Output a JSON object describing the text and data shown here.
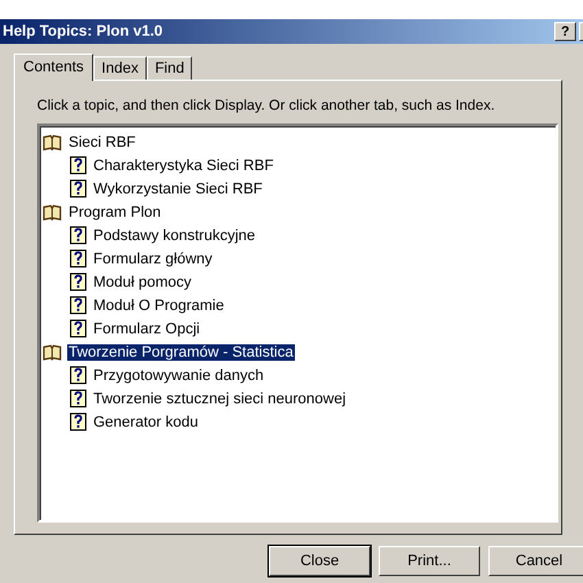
{
  "window": {
    "title": "Help Topics: Plon v1.0",
    "help_button": "?"
  },
  "tabs": [
    {
      "label": "Contents",
      "selected": true
    },
    {
      "label": "Index",
      "selected": false
    },
    {
      "label": "Find",
      "selected": false
    }
  ],
  "instruction": "Click a topic, and then click Display. Or click another tab, such as Index.",
  "tree": [
    {
      "kind": "book",
      "label": "Sieci RBF",
      "selected": false,
      "children": [
        {
          "kind": "topic",
          "label": "Charakterystyka Sieci RBF",
          "selected": false
        },
        {
          "kind": "topic",
          "label": "Wykorzystanie Sieci RBF",
          "selected": false
        }
      ]
    },
    {
      "kind": "book",
      "label": "Program Plon",
      "selected": false,
      "children": [
        {
          "kind": "topic",
          "label": "Podstawy konstrukcyjne",
          "selected": false
        },
        {
          "kind": "topic",
          "label": "Formularz główny",
          "selected": false
        },
        {
          "kind": "topic",
          "label": "Moduł pomocy",
          "selected": false
        },
        {
          "kind": "topic",
          "label": "Moduł O Programie",
          "selected": false
        },
        {
          "kind": "topic",
          "label": "Formularz Opcji",
          "selected": false
        }
      ]
    },
    {
      "kind": "book",
      "label": "Tworzenie Porgramów - Statistica",
      "selected": true,
      "children": [
        {
          "kind": "topic",
          "label": "Przygotowywanie danych",
          "selected": false
        },
        {
          "kind": "topic",
          "label": "Tworzenie sztucznej sieci neuronowej",
          "selected": false
        },
        {
          "kind": "topic",
          "label": "Generator kodu",
          "selected": false
        }
      ]
    }
  ],
  "buttons": [
    {
      "label": "Close",
      "default": true
    },
    {
      "label": "Print...",
      "default": false
    },
    {
      "label": "Cancel",
      "default": false
    }
  ]
}
